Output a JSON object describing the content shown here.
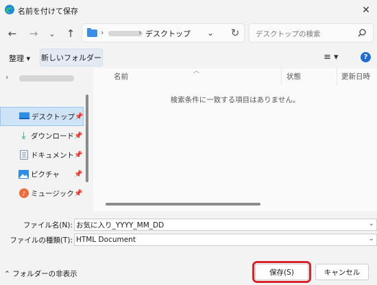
{
  "window": {
    "title": "名前を付けて保存",
    "close_label": "✕"
  },
  "nav": {
    "address_sep1": "›",
    "address_sep2": "›",
    "address_current": "デスクトップ",
    "search_placeholder": "デスクトップの検索"
  },
  "toolbar": {
    "organize_label": "整理 ▾",
    "new_folder_label": "新しいフォルダー",
    "view_label": "≡ ▾",
    "help_label": "?"
  },
  "sidebar": {
    "items": [
      {
        "label": "デスクトップ",
        "icon": "desktop-icon",
        "selected": true
      },
      {
        "label": "ダウンロード",
        "icon": "download-icon",
        "selected": false
      },
      {
        "label": "ドキュメント",
        "icon": "document-icon",
        "selected": false
      },
      {
        "label": "ピクチャ",
        "icon": "pictures-icon",
        "selected": false
      },
      {
        "label": "ミュージック",
        "icon": "music-icon",
        "selected": false
      }
    ]
  },
  "content": {
    "columns": [
      "名前",
      "状態",
      "更新日時"
    ],
    "empty_message": "検索条件に一致する項目はありません。"
  },
  "form": {
    "filename_label": "ファイル名(N):",
    "filename_value": "お気に入り_YYYY_MM_DD",
    "filetype_label": "ファイルの種類(T):",
    "filetype_value": "HTML Document"
  },
  "footer": {
    "hide_folders_label": "フォルダーの非表示",
    "save_label": "保存(S)",
    "cancel_label": "キャンセル"
  },
  "colors": {
    "accent": "#1f6fd0",
    "highlight_outline": "#d8232a",
    "selected_bg": "#cfe3f7"
  }
}
